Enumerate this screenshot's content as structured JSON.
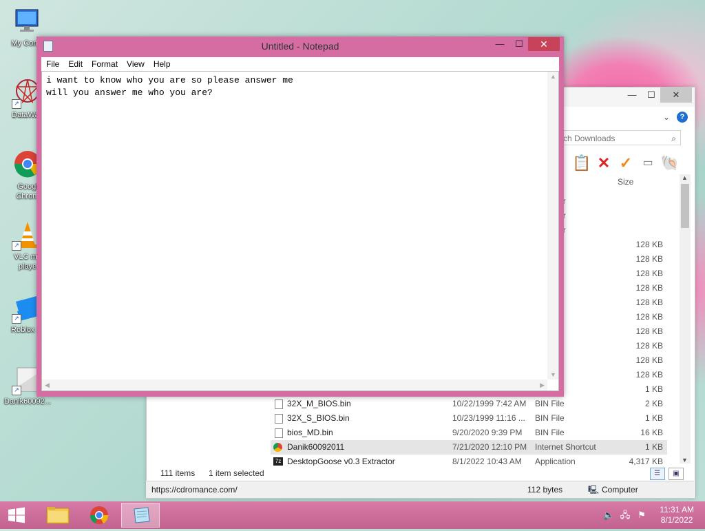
{
  "desktop": {
    "icons": [
      {
        "label": "My Comp"
      },
      {
        "label": "DataWag"
      },
      {
        "label": "Googl",
        "label2": "Chrom"
      },
      {
        "label": "VLC me",
        "label2": "playe"
      },
      {
        "label": "Roblox St"
      },
      {
        "label": "Danik60092..."
      }
    ]
  },
  "explorer": {
    "search_placeholder": "ch Downloads",
    "column_size": "Size",
    "type_fragments": [
      "er",
      "er",
      "er"
    ],
    "size_only_rows": [
      "128 KB",
      "128 KB",
      "128 KB",
      "128 KB",
      "128 KB",
      "128 KB",
      "128 KB",
      "128 KB",
      "128 KB",
      "128 KB",
      "1 KB"
    ],
    "rows": [
      {
        "name": "32X_M_BIOS.bin",
        "date": "10/22/1999 7:42 AM",
        "type": "BIN File",
        "size": "2 KB"
      },
      {
        "name": "32X_S_BIOS.bin",
        "date": "10/23/1999 11:16 ...",
        "type": "BIN File",
        "size": "1 KB"
      },
      {
        "name": "bios_MD.bin",
        "date": "9/20/2020 9:39 PM",
        "type": "BIN File",
        "size": "16 KB"
      },
      {
        "name": "Danik60092011",
        "date": "7/21/2020 12:10 PM",
        "type": "Internet Shortcut",
        "size": "1 KB"
      },
      {
        "name": "DesktopGoose v0.3 Extractor",
        "date": "8/1/2022 10:43 AM",
        "type": "Application",
        "size": "4,317 KB"
      }
    ],
    "status_items": "111 items",
    "status_selected": "1 item selected",
    "controls": {
      "minimize": "—",
      "maximize": "☐",
      "close": "✕"
    }
  },
  "browser_status": {
    "url": "https://cdromance.com/",
    "bytes": "112 bytes",
    "zone": "Computer"
  },
  "notepad": {
    "title": "Untitled - Notepad",
    "menu": [
      "File",
      "Edit",
      "Format",
      "View",
      "Help"
    ],
    "text": "i want to know who you are so please answer me\nwill you answer me who you are?",
    "controls": {
      "minimize": "—",
      "maximize": "☐",
      "close": "✕"
    }
  },
  "taskbar": {
    "time": "11:31 AM",
    "date": "8/1/2022"
  }
}
